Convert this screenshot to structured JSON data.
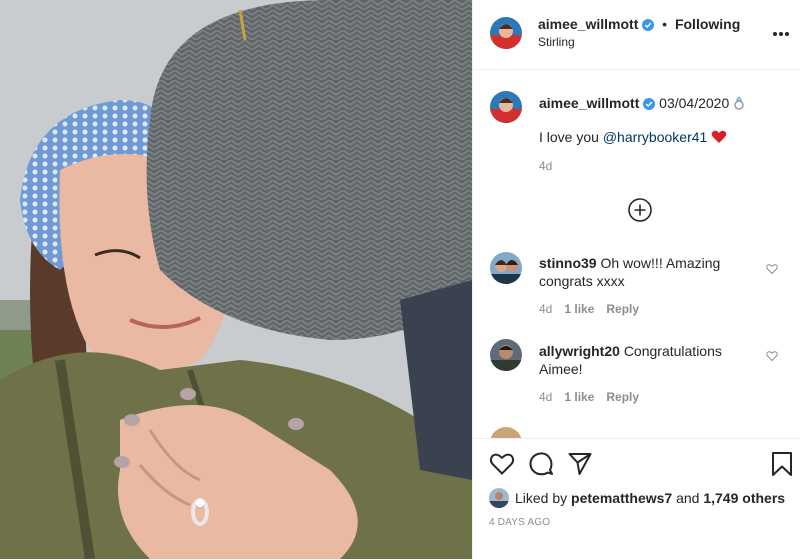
{
  "post": {
    "username": "aimee_willmott",
    "follow_status": "Following",
    "location": "Stirling",
    "more_icon": "more-options-icon"
  },
  "caption": {
    "username": "aimee_willmott",
    "date_text": "03/04/2020",
    "emoji": "ring-emoji",
    "text_prefix": "I love you",
    "mention": "@harrybooker41",
    "text_emoji": "red-heart-emoji",
    "age": "4d"
  },
  "comments": [
    {
      "username": "stinno39",
      "text": "Oh wow!!! Amazing congrats xxxx",
      "age": "4d",
      "likes": "1 like",
      "reply": "Reply"
    },
    {
      "username": "allywright20",
      "text": "Congratulations Aimee!",
      "age": "4d",
      "likes": "1 like",
      "reply": "Reply"
    }
  ],
  "actions": {
    "liked_by_prefix": "Liked by",
    "liked_by_user": "petematthews7",
    "liked_by_mid": "and",
    "liked_by_count": "1,749 others",
    "timestamp": "4 DAYS AGO"
  },
  "colors": {
    "text": "#262626",
    "muted": "#8e8e8e",
    "verified": "#3897f0",
    "mention": "#00376b",
    "heart": "#ed4956",
    "border": "#efefef"
  }
}
